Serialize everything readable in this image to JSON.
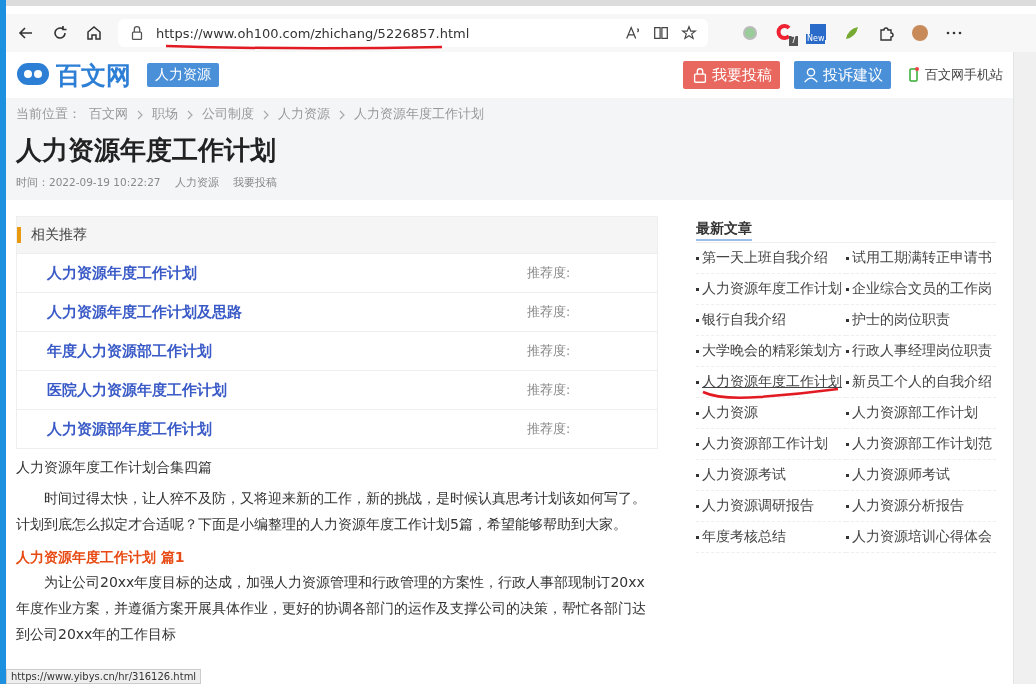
{
  "browser": {
    "url": "https://www.oh100.com/zhichang/5226857.html",
    "extension_badges": [
      "7",
      "New"
    ],
    "status_url": "https://www.yibys.cn/hr/316126.html"
  },
  "header": {
    "logo": "百文网",
    "category_tag": "人力资源",
    "buttons": [
      {
        "label": "我要投稿",
        "kind": "submit"
      },
      {
        "label": "投诉建议",
        "kind": "feedback"
      }
    ],
    "mobile_link": "百文网手机站"
  },
  "breadcrumb": {
    "label": "当前位置：",
    "items": [
      "百文网",
      "职场",
      "公司制度",
      "人力资源",
      "人力资源年度工作计划"
    ]
  },
  "article": {
    "title": "人力资源年度工作计划",
    "time": "时间：2022-09-19 10:22:27",
    "meta_links": [
      "人力资源",
      "我要投稿"
    ],
    "related": {
      "heading": "相关推荐",
      "items": [
        {
          "title": "人力资源年度工作计划",
          "rating_label": "推荐度:"
        },
        {
          "title": "人力资源年度工作计划及思路",
          "rating_label": "推荐度:"
        },
        {
          "title": "年度人力资源部工作计划",
          "rating_label": "推荐度:"
        },
        {
          "title": "医院人力资源年度工作计划",
          "rating_label": "推荐度:"
        },
        {
          "title": "人力资源部年度工作计划",
          "rating_label": "推荐度:"
        }
      ]
    },
    "intro": "人力资源年度工作计划合集四篇",
    "paragraphs": [
      "时间过得太快，让人猝不及防，又将迎来新的工作，新的挑战，是时候认真思考计划该如何写了。计划到底怎么拟定才合适呢？下面是小编整理的人力资源年度工作计划5篇，希望能够帮助到大家。"
    ],
    "section_heading": "人力资源年度工作计划 篇1",
    "section_paragraphs": [
      "为让公司20xx年度目标的达成，加强人力资源管理和行政管理的方案性，行政人事部现制订20xx年度作业方案，并遵循方案开展具体作业，更好的协调各部门的运作及支撑公司的决策，帮忙各部门达到公司20xx年的工作目标"
    ]
  },
  "sidebar": {
    "heading": "最新文章",
    "items": [
      {
        "title": "第一天上班自我介绍",
        "hovered": false
      },
      {
        "title": "试用工期满转正申请书",
        "hovered": false
      },
      {
        "title": "人力资源年度工作计划",
        "hovered": false
      },
      {
        "title": "企业综合文员的工作岗",
        "hovered": false
      },
      {
        "title": "银行自我介绍",
        "hovered": false
      },
      {
        "title": "护士的岗位职责",
        "hovered": false
      },
      {
        "title": "大学晚会的精彩策划方",
        "hovered": false
      },
      {
        "title": "行政人事经理岗位职责",
        "hovered": false
      },
      {
        "title": "人力资源年度工作计划",
        "hovered": true
      },
      {
        "title": "新员工个人的自我介绍",
        "hovered": false
      },
      {
        "title": "人力资源",
        "hovered": false
      },
      {
        "title": "人力资源部工作计划",
        "hovered": false
      },
      {
        "title": "人力资源部工作计划",
        "hovered": false
      },
      {
        "title": "人力资源部工作计划范",
        "hovered": false
      },
      {
        "title": "人力资源考试",
        "hovered": false
      },
      {
        "title": "人力资源师考试",
        "hovered": false
      },
      {
        "title": "人力资源调研报告",
        "hovered": false
      },
      {
        "title": "人力资源分析报告",
        "hovered": false
      },
      {
        "title": "年度考核总结",
        "hovered": false
      },
      {
        "title": "人力资源培训心得体会",
        "hovered": false
      }
    ]
  }
}
